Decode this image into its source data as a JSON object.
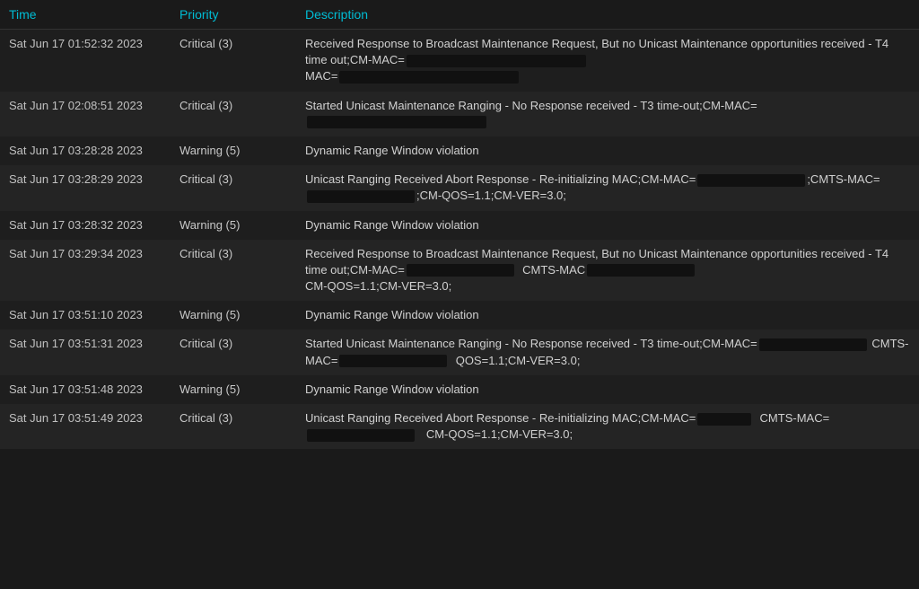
{
  "header": {
    "col_time": "Time",
    "col_priority": "Priority",
    "col_description": "Description"
  },
  "rows": [
    {
      "time": "Sat Jun 17 01:52:32 2023",
      "priority": "Critical (3)",
      "description": "Received Response to Broadcast Maintenance Request, But no Unicast Maintenance opportunities received - T4 time out;CM-MAC=",
      "desc_suffix": "MAC=",
      "type": "critical_t4"
    },
    {
      "time": "Sat Jun 17 02:08:51 2023",
      "priority": "Critical (3)",
      "description": "Started Unicast Maintenance Ranging - No Response received - T3 time-out;CM-MAC=",
      "type": "critical_t3a"
    },
    {
      "time": "Sat Jun 17 03:28:28 2023",
      "priority": "Warning (5)",
      "description": "Dynamic Range Window violation",
      "type": "warning"
    },
    {
      "time": "Sat Jun 17 03:28:29 2023",
      "priority": "Critical (3)",
      "description": "Unicast Ranging Received Abort Response - Re-initializing MAC;CM-MAC=",
      "desc_cmts": ";CMTS-MAC=",
      "desc_qos": ";CM-QOS=1.1;CM-VER=3.0;",
      "type": "critical_abort"
    },
    {
      "time": "Sat Jun 17 03:28:32 2023",
      "priority": "Warning (5)",
      "description": "Dynamic Range Window violation",
      "type": "warning"
    },
    {
      "time": "Sat Jun 17 03:29:34 2023",
      "priority": "Critical (3)",
      "description": "Received Response to Broadcast Maintenance Request, But no Unicast Maintenance opportunities received - T4 time out;CM-MAC=",
      "desc_cmts": "CMTS-MAC",
      "desc_qos": "CM-QOS=1.1;CM-VER=3.0;",
      "type": "critical_t4b"
    },
    {
      "time": "Sat Jun 17 03:51:10 2023",
      "priority": "Warning (5)",
      "description": "Dynamic Range Window violation",
      "type": "warning"
    },
    {
      "time": "Sat Jun 17 03:51:31 2023",
      "priority": "Critical (3)",
      "description": "Started Unicast Maintenance Ranging - No Response received - T3 time-out;CM-MAC=",
      "desc_cmts": "CMTS-MAC=",
      "desc_qos": "QOS=1.1;CM-VER=3.0;",
      "type": "critical_t3b"
    },
    {
      "time": "Sat Jun 17 03:51:48 2023",
      "priority": "Warning (5)",
      "description": "Dynamic Range Window violation",
      "type": "warning"
    },
    {
      "time": "Sat Jun 17 03:51:49 2023",
      "priority": "Critical (3)",
      "description": "Unicast Ranging Received Abort Response - Re-initializing MAC;CM-MAC=",
      "desc_cmts": "CMTS-MAC=",
      "desc_qos": "CM-QOS=1.1;CM-VER=3.0;",
      "type": "critical_abort2"
    }
  ]
}
